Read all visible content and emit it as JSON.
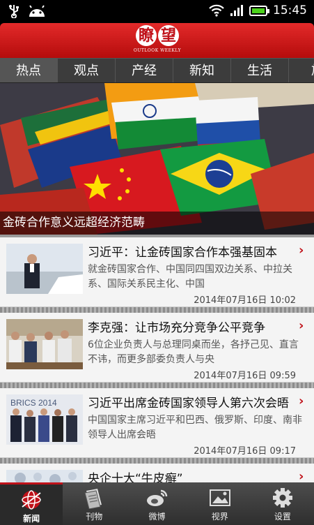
{
  "status_bar": {
    "time": "15:45"
  },
  "header": {
    "logo_cn_1": "瞭",
    "logo_cn_2": "望",
    "logo_en": "OUTLOOK WEEKLY"
  },
  "tabs": [
    "热点",
    "观点",
    "产经",
    "新知",
    "生活",
    "旅"
  ],
  "hero": {
    "caption": "金砖合作意义远超经济范畴"
  },
  "articles": [
    {
      "title": "习近平：让金砖国家合作本强基固本",
      "summary": "就金砖国家合作、中国同四国双边关系、中拉关系、国际关系民主化、中国",
      "date": "2014年07月16日 10:02"
    },
    {
      "title": "李克强：让市场充分竞争公平竞争",
      "summary": "6位企业负责人与总理同桌而坐，各抒己见、直言不讳，而更多部委负责人与央",
      "date": "2014年07月16日 09:59"
    },
    {
      "title": "习近平出席金砖国家领导人第六次会晤",
      "summary": "中国国家主席习近平和巴西、俄罗斯、印度、南非领导人出席会晤",
      "date": "2014年07月16日 09:17",
      "thumb_text": "BRICS 2014"
    },
    {
      "title": "央企十大“牛皮癣”"
    }
  ],
  "bottom_nav": [
    {
      "label": "新闻",
      "icon": "news-globe-icon"
    },
    {
      "label": "刊物",
      "icon": "magazine-icon"
    },
    {
      "label": "微博",
      "icon": "weibo-icon"
    },
    {
      "label": "视界",
      "icon": "picture-icon"
    },
    {
      "label": "设置",
      "icon": "gear-icon"
    }
  ],
  "colors": {
    "brand_red": "#c0121a",
    "tab_bar": "#3c3c3c",
    "battery_green": "#4cd21c"
  }
}
